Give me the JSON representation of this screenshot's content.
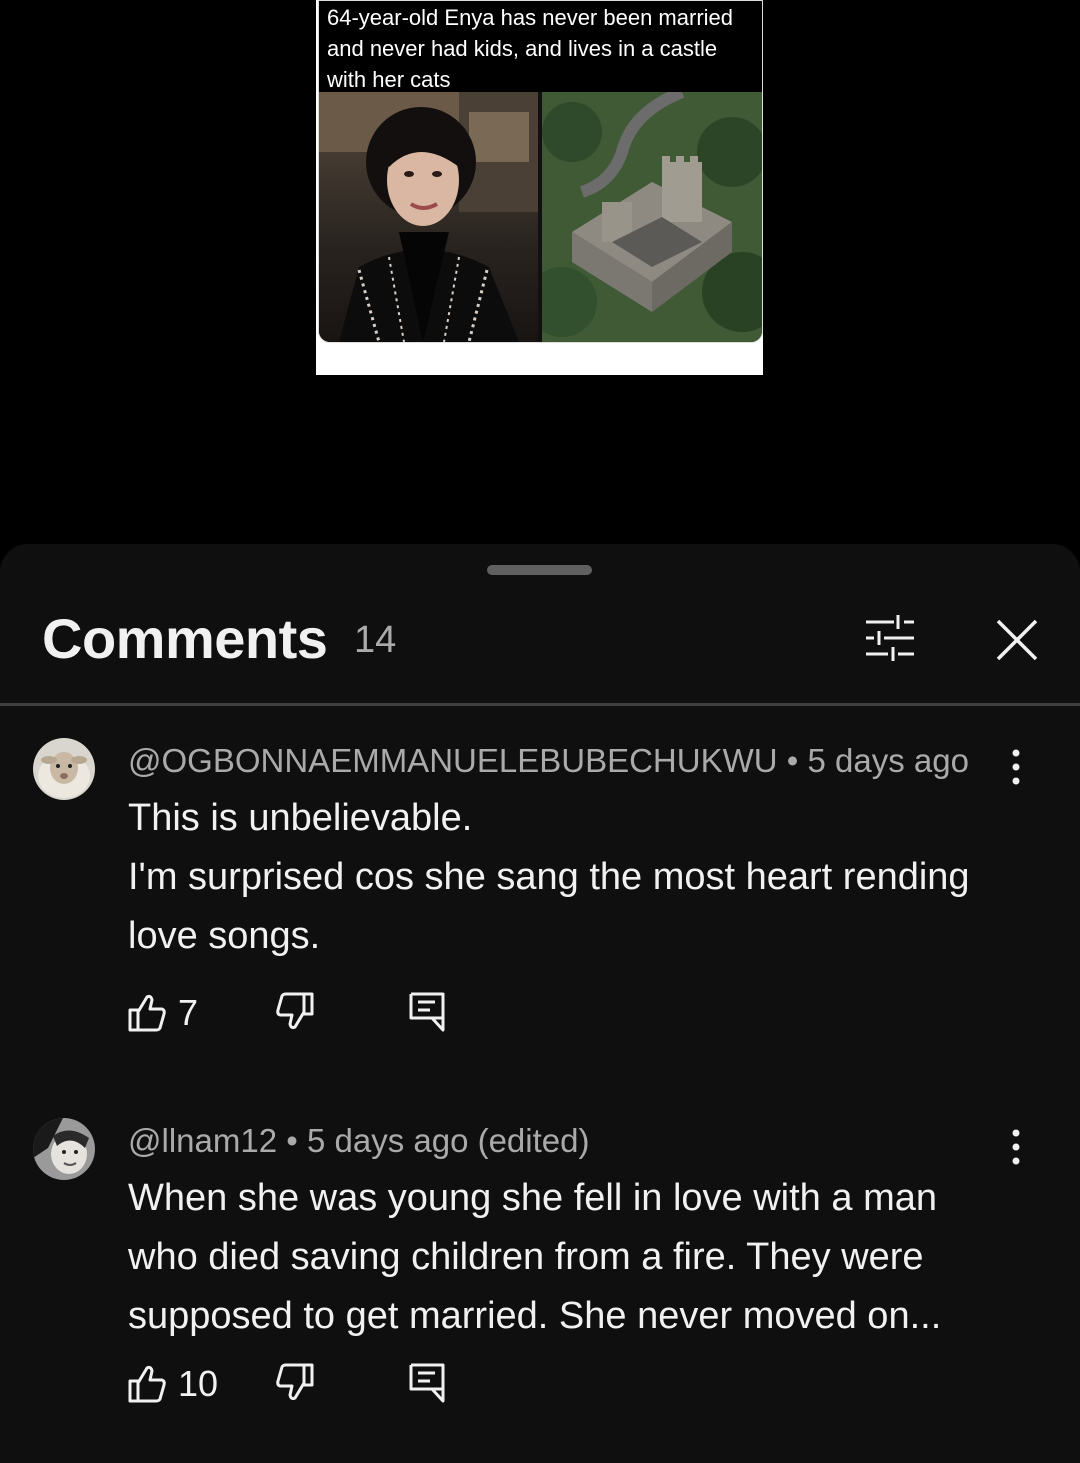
{
  "thumbnail": {
    "caption": "64-year-old Enya has never been married and never had kids, and lives in a castle with her cats"
  },
  "comments_panel": {
    "title": "Comments",
    "count": "14",
    "filter_icon": "sort-filter-icon",
    "close_icon": "close-icon"
  },
  "comments": [
    {
      "author": "@OGBONNAEMMANUELEBUBECHUKWU",
      "time": " • 5 days ago",
      "lines": [
        "This is unbelievable.",
        "I'm surprised cos she sang the most heart rending love songs."
      ],
      "likes": "7"
    },
    {
      "author": "@llnam12",
      "time": " • 5 days ago (edited)",
      "lines": [
        "When she was young she fell in love with a man who died saving children from a fire. They were supposed to get married. She never moved on..."
      ],
      "likes": "10"
    }
  ],
  "colors": {
    "sheet_bg": "#0f0f0f",
    "text_primary": "#f1f1f1",
    "text_secondary": "#aaaaaa",
    "divider": "#3f3f3f"
  }
}
